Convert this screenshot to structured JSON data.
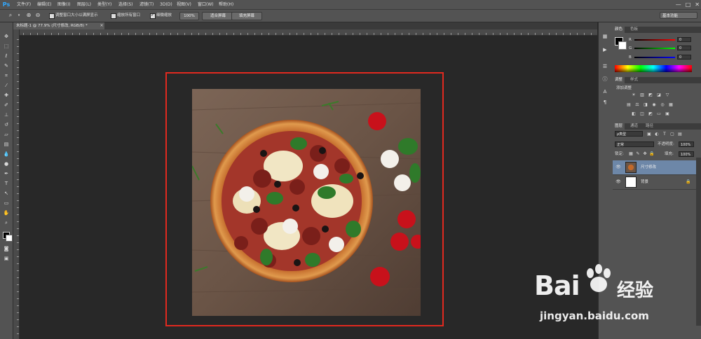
{
  "app": {
    "logo": "Ps"
  },
  "menu": [
    "文件(F)",
    "编辑(E)",
    "图像(I)",
    "图层(L)",
    "类型(Y)",
    "选择(S)",
    "滤镜(T)",
    "3D(D)",
    "视图(V)",
    "窗口(W)",
    "帮助(H)"
  ],
  "window_controls": [
    "—",
    "□",
    "✕"
  ],
  "options_bar": {
    "resize_windows_label": "调整窗口大小以满屏显示",
    "zoom_all_label": "缩放所有窗口",
    "scrubby_label": "细微缩放",
    "btn_100": "100%",
    "btn_fit": "适合屏幕",
    "btn_fill": "填充屏幕",
    "workspace": "基本功能"
  },
  "document": {
    "tab_title": "未标题-1 @ 77.9% (尺寸修改, RGB/8) *",
    "tab_close": "×"
  },
  "color_panel": {
    "tabs": [
      "颜色",
      "色板"
    ],
    "r_label": "R",
    "g_label": "G",
    "b_label": "B",
    "r_value": "0",
    "g_value": "0",
    "b_value": "0"
  },
  "adjust_panel": {
    "tabs": [
      "调整",
      "样式"
    ],
    "title": "添加调整"
  },
  "layers_panel": {
    "tabs": [
      "图层",
      "通道",
      "路径"
    ],
    "filter_kind": "ρ类型",
    "blend_mode": "正常",
    "opacity_label": "不透明度:",
    "opacity_value": "100%",
    "lock_label": "锁定:",
    "fill_label": "填充:",
    "fill_value": "100%",
    "layers": [
      {
        "name": "尺寸修改",
        "selected": true
      },
      {
        "name": "背景",
        "selected": false
      }
    ]
  },
  "watermark": {
    "brand_a": "Bai",
    "brand_b": "经验",
    "url": "jingyan.baidu.com"
  },
  "colors": {
    "highlight": "#e1291f",
    "selected_layer": "#6d87a8"
  }
}
